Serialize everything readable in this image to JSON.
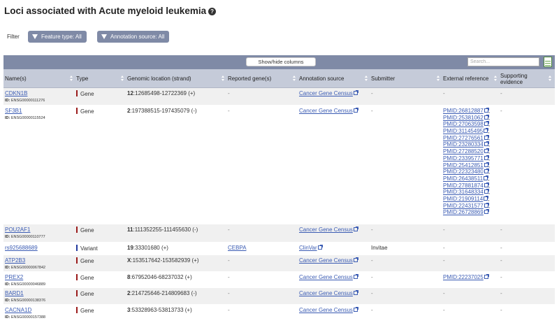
{
  "page": {
    "title": "Loci associated with Acute myeloid leukemia",
    "help_icon": "help-icon"
  },
  "filter": {
    "label": "Filter",
    "buttons": [
      "Feature type: All",
      "Annotation source: All"
    ]
  },
  "toolbar": {
    "show_hide_label": "Show/hide columns",
    "search_placeholder": "Search...",
    "export_icon": "spreadsheet-export-icon"
  },
  "columns": [
    "Name(s)",
    "Type",
    "Genomic location (strand)",
    "Reported gene(s)",
    "Annotation source",
    "Submitter",
    "External reference",
    "Supporting evidence"
  ],
  "colors": {
    "gene": "#9a1b1b",
    "variant": "#233b9e",
    "link": "#3a5bb3",
    "header_bg": "#c5cbd9",
    "toolbar_bg": "#7f8aa6"
  },
  "rows": [
    {
      "name": "CDKN1B",
      "id_label": "ID:",
      "id": "ENSG00000111276",
      "type": "Gene",
      "loc_chr": "12",
      "loc_rest": ":12685498-12722369 (+)",
      "reported": "-",
      "source": "Cancer Gene Census",
      "submitter": "-",
      "external": [
        "-"
      ],
      "evidence": "-"
    },
    {
      "name": "SF3B1",
      "id_label": "ID:",
      "id": "ENSG00000115524",
      "type": "Gene",
      "loc_chr": "2",
      "loc_rest": ":197388515-197435079 (-)",
      "reported": "-",
      "source": "Cancer Gene Census",
      "submitter": "-",
      "external": [
        "PMID:26812887",
        "PMID:25381062",
        "PMID:27063598",
        "PMID:31145495",
        "PMID:27276561",
        "PMID:23280334",
        "PMID:27288520",
        "PMID:23395771",
        "PMID:25412851",
        "PMID:22323480",
        "PMID:26438511",
        "PMID:27881874",
        "PMID:31648334",
        "PMID:21909114",
        "PMID:22431577",
        "PMID:26728869"
      ],
      "evidence": "-"
    },
    {
      "name": "POU2AF1",
      "id_label": "ID:",
      "id": "ENSG00000110777",
      "type": "Gene",
      "loc_chr": "11",
      "loc_rest": ":111352255-111455630 (-)",
      "reported": "-",
      "source": "Cancer Gene Census",
      "submitter": "-",
      "external": [
        "-"
      ],
      "evidence": "-"
    },
    {
      "name": "rs925688689",
      "id_label": "",
      "id": "",
      "type": "Variant",
      "loc_chr": "19",
      "loc_rest": ":33301680 (+)",
      "reported": "CEBPA",
      "source": "ClinVar",
      "submitter": "Invitae",
      "external": [
        "-"
      ],
      "evidence": "-"
    },
    {
      "name": "ATP2B3",
      "id_label": "ID:",
      "id": "ENSG00000067842",
      "type": "Gene",
      "loc_chr": "X",
      "loc_rest": ":153517642-153582939 (+)",
      "reported": "-",
      "source": "Cancer Gene Census",
      "submitter": "-",
      "external": [
        "-"
      ],
      "evidence": "-"
    },
    {
      "name": "PREX2",
      "id_label": "ID:",
      "id": "ENSG00000046889",
      "type": "Gene",
      "loc_chr": "8",
      "loc_rest": ":67952046-68237032 (+)",
      "reported": "-",
      "source": "Cancer Gene Census",
      "submitter": "-",
      "external": [
        "PMID:22237025"
      ],
      "evidence": "-"
    },
    {
      "name": "BARD1",
      "id_label": "ID:",
      "id": "ENSG00000138376",
      "type": "Gene",
      "loc_chr": "2",
      "loc_rest": ":214725646-214809683 (-)",
      "reported": "-",
      "source": "Cancer Gene Census",
      "submitter": "-",
      "external": [
        "-"
      ],
      "evidence": "-"
    },
    {
      "name": "CACNA1D",
      "id_label": "ID:",
      "id": "ENSG00000157388",
      "type": "Gene",
      "loc_chr": "3",
      "loc_rest": ":53328963-53813733 (+)",
      "reported": "-",
      "source": "Cancer Gene Census",
      "submitter": "-",
      "external": [
        "-"
      ],
      "evidence": "-"
    }
  ]
}
